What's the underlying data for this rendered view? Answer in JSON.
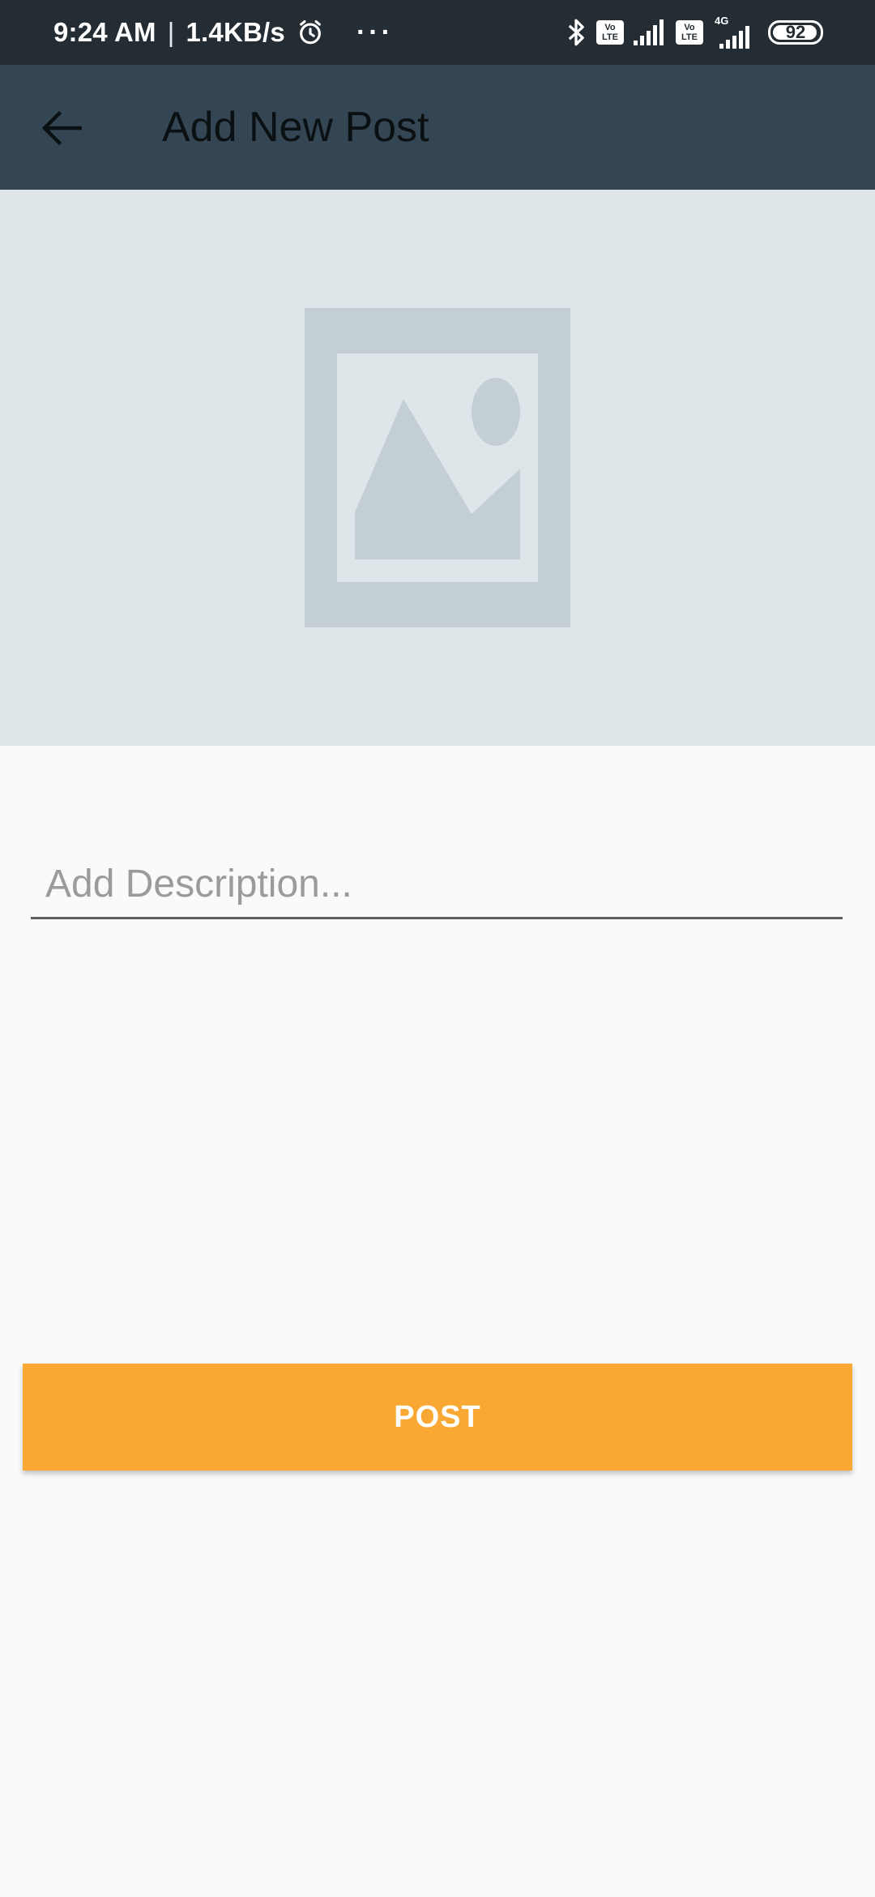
{
  "status_bar": {
    "time": "9:24 AM",
    "separator": "|",
    "speed": "1.4KB/s",
    "dots": "···",
    "volte_badge_1": "Vo LTE",
    "volte_badge_2": "Vo LTE",
    "network_label": "4G",
    "battery_level": "92",
    "icons": [
      "alarm-icon",
      "bluetooth-icon",
      "signal-icon",
      "signal-icon",
      "battery-icon"
    ]
  },
  "app_bar": {
    "title": "Add New Post",
    "back_icon": "arrow-back-icon"
  },
  "image_picker": {
    "icon": "image-placeholder-icon"
  },
  "description": {
    "placeholder": "Add Description...",
    "value": ""
  },
  "post_button": {
    "label": "POST"
  },
  "colors": {
    "status_bar": "#242d33",
    "app_bar": "#344653",
    "image_area": "#dfe6ea",
    "placeholder_icon": "#c3cfd5",
    "background": "#fafafa",
    "accent": "#f9a933"
  }
}
